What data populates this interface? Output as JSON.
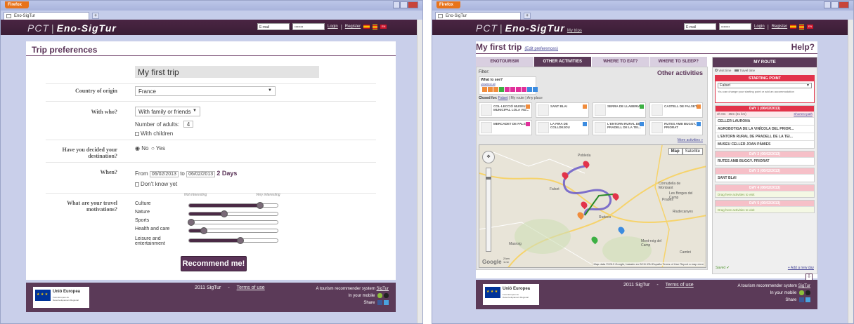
{
  "browser": {
    "menu_label": "Firefox",
    "tab_title": "Eno-SigTur",
    "new_tab": "+"
  },
  "header": {
    "logo_pct": "PCT",
    "logo_sep": "|",
    "logo_name": "Eno-SigTur",
    "my_trips": "My trips",
    "email_placeholder": "E-mail",
    "password_mask": "•••••••",
    "login": "Login",
    "register": "Register",
    "pipe": "|",
    "lang_label": "EN"
  },
  "prefs": {
    "title": "Trip preferences",
    "trip_name": "My first trip",
    "country_label": "Country of origin",
    "country_value": "France",
    "withwho_label": "With who?",
    "withwho_value": "With family or friends",
    "adults_label": "Number of adults:",
    "adults_value": "4",
    "with_children": "With children",
    "destination_label_1": "Have you decided your",
    "destination_label_2": "destination?",
    "dest_no": "◉ No",
    "dest_yes": "○ Yes",
    "when_label": "When?",
    "from_label": "From",
    "from_date": "06/02/2013",
    "to_label": "to",
    "to_date": "06/02/2013",
    "days": "2 Days",
    "dont_know": "Don't know yet",
    "motivations_label_1": "What are your travel",
    "motivations_label_2": "motivations?",
    "scale_low": "Not interesting",
    "scale_high": "Very interesting",
    "motivations": [
      {
        "label": "Culture",
        "value": 0.8
      },
      {
        "label": "Nature",
        "value": 0.4
      },
      {
        "label": "Sports",
        "value": 0.02
      },
      {
        "label": "Health and care",
        "value": 0.17
      },
      {
        "label": "Leisure and entertainment",
        "value": 0.58
      }
    ],
    "recommend": "Recommend me!"
  },
  "footer": {
    "eu_title": "Unió Europea",
    "eu_fine": "Fons Europeu de Desenvolupament Regional",
    "eu_motto": "Una manera de fer Europa",
    "copyright": "2011 SigTur",
    "dash": "-",
    "terms": "Terms of use",
    "tagline": "A tourism recommender system",
    "tagline_link": "SigTur",
    "in_mobile": "In your mobile",
    "share": "Share"
  },
  "trip": {
    "title": "My first trip",
    "edit_prefs": "(Edit preferences)",
    "help": "Help?",
    "tabs": [
      "ENOTOURISM",
      "OTHER ACTIVITIES",
      "WHERE TO EAT?",
      "WHERE TO SLEEP?"
    ],
    "filter_label": "Filter:",
    "what_to_see": "What to see?",
    "what_to_see_sub": "Unselect all",
    "panel_heading": "Other activities",
    "closed_for": "Closed for:",
    "closed_falset": "Falset",
    "closed_myroute": "My route",
    "closed_any": "Any place",
    "closed_sep": "|",
    "activities": [
      "COL·LECCIÓ MUSEU MUNICIPAL LOLA VID...",
      "SANT BLAI",
      "SERRA DE LLABERIA",
      "CASTELL DE FALSET",
      "MERCADET DE FALSET",
      "LA FIRA DE COLLDEJOU",
      "L'ENTORN RURAL DE PRADELL DE LA TEI...",
      "RUTES AMB BUGGY. PRIORAT"
    ],
    "more_activities": "More activities »",
    "map_btn": "Map",
    "satellite_btn": "Satellite",
    "map_copy": "Map data ©2013 Google, basado en BCN IGN España Terms of Use  Report a map error",
    "google": "Google",
    "scale_2km": "2 km",
    "scale_1mi": "1 mi",
    "map_places": [
      "Pobleda",
      "Falset",
      "Rudeco",
      "Cornudella de Montsant",
      "Riudecanyes",
      "Mont-roig del Camp",
      "Cambri",
      "Prades",
      "Masroig",
      "Les Borges del Camp"
    ]
  },
  "route": {
    "title": "MY ROUTE",
    "legend_visit": "Visit time",
    "legend_travel": "Travel time",
    "start_title": "STARTING POINT",
    "start_value": "Falset",
    "start_note": "You can change your starting point or add an accommodation",
    "days": [
      {
        "title": "DAY 1 (06/02/2013)",
        "sub": "3h 0m  ·  35m (31 km)",
        "link": "Shortest path",
        "items": [
          "CELLER LAURONA",
          "AGROBOTIGA DE LA VINÍCOLA DEL PRIOR...",
          "L'ENTORN RURAL DE PRADELL DE LA TEI...",
          "MUSEU CELLER JOAN PÀMIES"
        ]
      },
      {
        "title": "DAY 2 (06/02/2013)",
        "items": [
          "RUTES AMB BUGGY. PRIORAT"
        ]
      },
      {
        "title": "DAY 3 (06/02/2013)",
        "items": [
          "SANT BLAI"
        ]
      },
      {
        "title": "DAY 4 (06/02/2013)",
        "empty": "Drag here activities to visit"
      },
      {
        "title": "DAY 5 (06/02/2013)",
        "empty": "Drag here activities to visit"
      }
    ],
    "saved": "Saved ✔",
    "add_day": "+ Add a new day"
  },
  "colors": {
    "header_bg": "#3a1d35",
    "brand_purple": "#5b3a58",
    "route_red": "#e2334a",
    "browser_frame": "#c9cfea"
  }
}
